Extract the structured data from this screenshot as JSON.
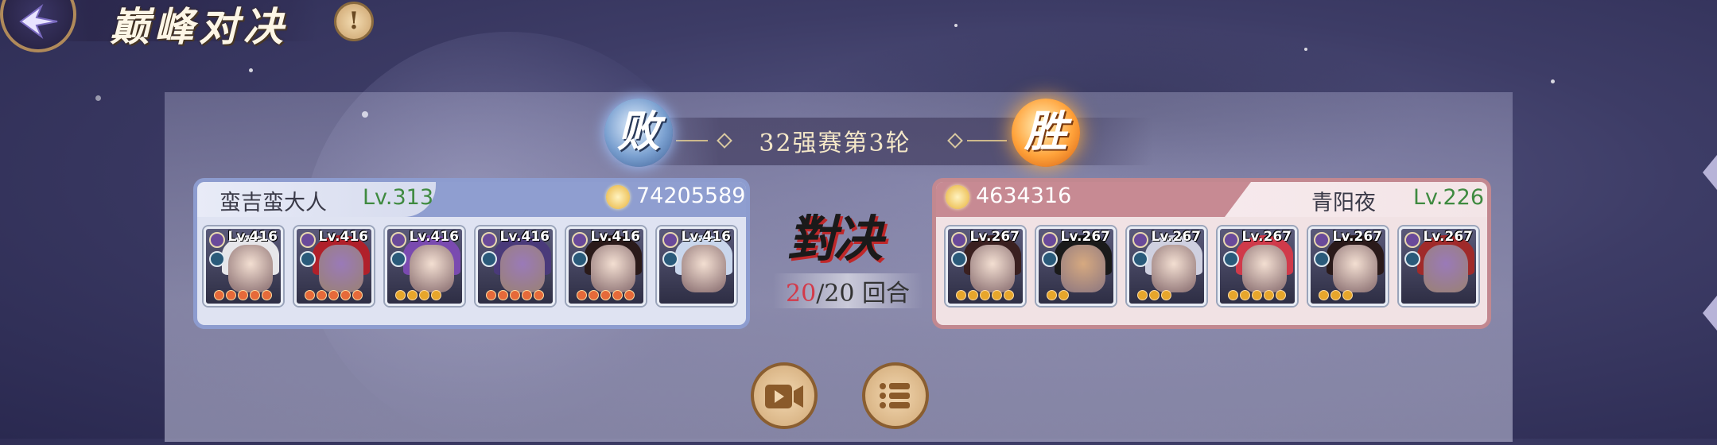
{
  "header": {
    "title": "巅峰对决",
    "back_icon": "back-arrow-icon",
    "info_icon": "exclamation-icon",
    "info_label": "!"
  },
  "round": {
    "label": "32强赛第3轮",
    "left_result": "败",
    "right_result": "胜"
  },
  "center": {
    "versus_label": "對决",
    "turns_current": "20",
    "turns_rest": "/20 回合"
  },
  "left_player": {
    "name": "蛮吉蛮大人",
    "level": "Lv.313",
    "power": "74205589",
    "units": [
      {
        "level": "Lv.416",
        "hair": "#e6e6ea",
        "face_tint": "light",
        "stars": 5,
        "star_color": "#e56a3a"
      },
      {
        "level": "Lv.416",
        "hair": "#b0202a",
        "face_tint": "purple",
        "stars": 5,
        "star_color": "#e56a3a"
      },
      {
        "level": "Lv.416",
        "hair": "#7a4ab0",
        "face_tint": "light",
        "stars": 4,
        "star_color": "#e7a62c"
      },
      {
        "level": "Lv.416",
        "hair": "#4a3a7a",
        "face_tint": "purple",
        "stars": 5,
        "star_color": "#e56a3a"
      },
      {
        "level": "Lv.416",
        "hair": "#2a1a1a",
        "face_tint": "light",
        "stars": 5,
        "star_color": "#e56a3a"
      },
      {
        "level": "Lv.416",
        "hair": "#c9d6ec",
        "face_tint": "light",
        "stars": 0,
        "star_color": "#e56a3a"
      }
    ]
  },
  "right_player": {
    "name": "青阳夜",
    "level": "Lv.226",
    "power": "4634316",
    "units": [
      {
        "level": "Lv.267",
        "hair": "#3a2020",
        "face_tint": "light",
        "stars": 5,
        "star_color": "#e7a62c"
      },
      {
        "level": "Lv.267",
        "hair": "#1a1a1a",
        "face_tint": "tan",
        "stars": 2,
        "star_color": "#e7a62c"
      },
      {
        "level": "Lv.267",
        "hair": "#cfd0e0",
        "face_tint": "light",
        "stars": 3,
        "star_color": "#e7a62c"
      },
      {
        "level": "Lv.267",
        "hair": "#d03a4a",
        "face_tint": "light",
        "stars": 5,
        "star_color": "#e7a62c"
      },
      {
        "level": "Lv.267",
        "hair": "#2a1a1a",
        "face_tint": "light",
        "stars": 3,
        "star_color": "#e7a62c"
      },
      {
        "level": "Lv.267",
        "hair": "#a02a2a",
        "face_tint": "purple",
        "stars": 0,
        "star_color": "#e7a62c"
      }
    ]
  },
  "buttons": {
    "replay_icon": "video-replay-icon",
    "details_icon": "list-icon"
  },
  "colors": {
    "win": "#ffa23a",
    "lose": "#7aa0d0",
    "level_green": "#3f8a40",
    "left_border": "#8d9ccf",
    "right_border": "#c28890"
  }
}
